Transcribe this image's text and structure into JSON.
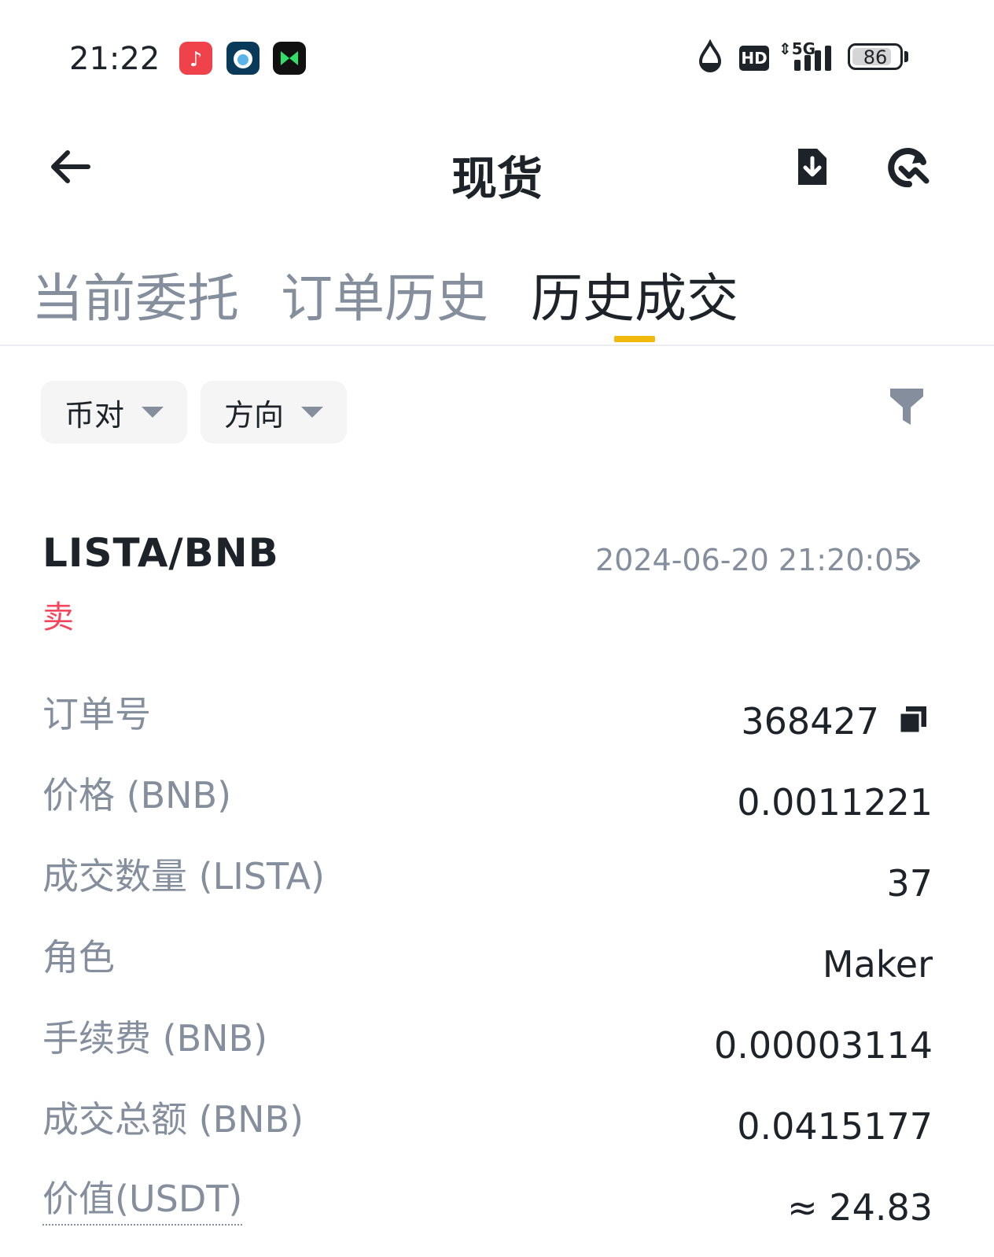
{
  "status_bar": {
    "time": "21:22",
    "network": "5G",
    "hd": "HD",
    "battery": "86",
    "battery_level_percent": 86,
    "app_icons": [
      "music-app-icon",
      "bird-app-icon",
      "game-app-icon"
    ]
  },
  "header": {
    "title": "现货",
    "back_icon": "back-arrow-icon",
    "download_icon": "download-icon",
    "refresh_icon": "refresh-chart-icon"
  },
  "tabs": [
    {
      "label": "当前委托",
      "active": false
    },
    {
      "label": "订单历史",
      "active": false
    },
    {
      "label": "历史成交",
      "active": true
    }
  ],
  "filters": {
    "pair_label": "币对",
    "direction_label": "方向",
    "filter_icon": "filter-icon"
  },
  "trade": {
    "pair": "LISTA/BNB",
    "side": "卖",
    "time": "2024-06-20 21:20:05",
    "rows": [
      {
        "label": "订单号",
        "value": "368427"
      },
      {
        "label": "价格 (BNB)",
        "value": "0.0011221"
      },
      {
        "label": "成交数量 (LISTA)",
        "value": "37"
      },
      {
        "label": "角色",
        "value": "Maker"
      },
      {
        "label": "手续费 (BNB)",
        "value": "0.00003114"
      },
      {
        "label": "成交总额 (BNB)",
        "value": "0.0415177"
      },
      {
        "label": "价值(USDT)",
        "value": "≈ 24.83"
      }
    ]
  },
  "colors": {
    "accent": "#f0b90b",
    "sell": "#f6465d",
    "secondary_text": "#848e9c",
    "primary_text": "#1e2329"
  }
}
